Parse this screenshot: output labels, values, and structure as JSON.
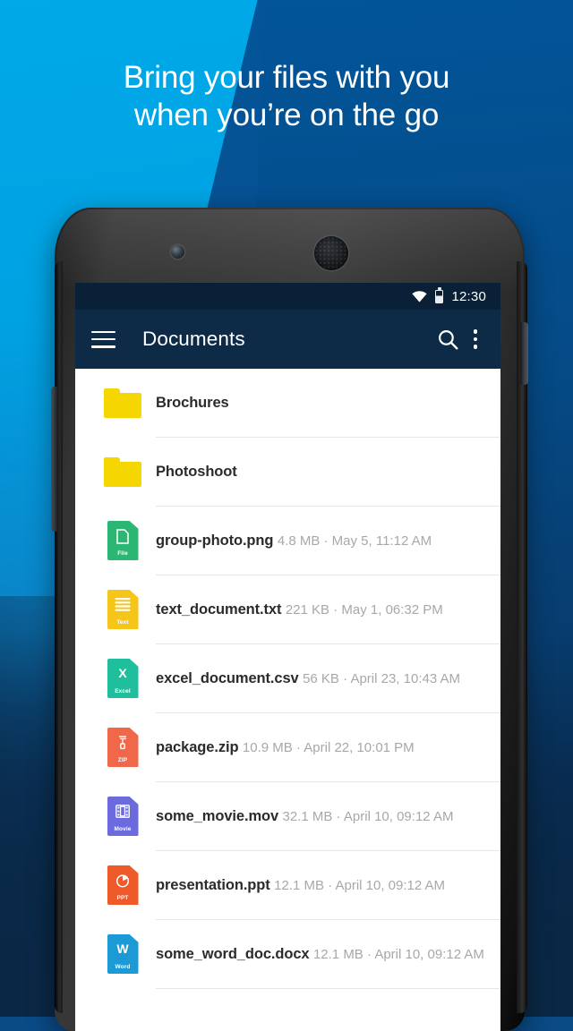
{
  "promo": {
    "headline_line1": "Bring your files with you",
    "headline_line2": "when you’re on the go",
    "bg_color_light": "#00a9e8",
    "bg_color_mid": "#04559a",
    "bg_color_dark": "#0a2845"
  },
  "device": {
    "front_camera": "camera-icon",
    "earpiece_speaker": "speaker-grille-icon",
    "volume_button": "volume-rocker",
    "power_button": "power-button"
  },
  "statusbar": {
    "wifi_icon": "wifi-icon",
    "battery_icon": "battery-icon",
    "time": "12:30",
    "background": "#0a2037"
  },
  "appbar": {
    "menu_icon": "hamburger-menu-icon",
    "title": "Documents",
    "search_icon": "search-icon",
    "overflow_icon": "more-vertical-icon",
    "background": "#0d2a47"
  },
  "filelist": [
    {
      "type": "folder",
      "icon": "folder-icon",
      "icon_color": "#f5d600",
      "name": "Brochures",
      "subtitle": ""
    },
    {
      "type": "folder",
      "icon": "folder-icon",
      "icon_color": "#f5d600",
      "name": "Photoshoot",
      "subtitle": ""
    },
    {
      "type": "file",
      "icon": "file-icon",
      "icon_color": "#2bb673",
      "badge": "File",
      "glyph": "page",
      "name": "group-photo.png",
      "size": "4.8 MB",
      "date": "May 5, 11:12 AM",
      "subtitle": "4.8 MB · May 5, 11:12 AM"
    },
    {
      "type": "file",
      "icon": "text-file-icon",
      "icon_color": "#f5c518",
      "badge": "Text",
      "glyph": "lines",
      "name": "text_document.txt",
      "size": "221 KB",
      "date": "May 1, 06:32 PM",
      "subtitle": "221 KB · May 1, 06:32 PM"
    },
    {
      "type": "file",
      "icon": "excel-file-icon",
      "icon_color": "#1fbe9c",
      "badge": "Excel",
      "glyph": "X",
      "name": "excel_document.csv",
      "size": "56 KB",
      "date": "April 23, 10:43 AM",
      "subtitle": "56 KB · April 23, 10:43 AM"
    },
    {
      "type": "file",
      "icon": "zip-file-icon",
      "icon_color": "#f0674a",
      "badge": "ZIP",
      "glyph": "zipper",
      "name": "package.zip",
      "size": "10.9 MB",
      "date": "April 22, 10:01 PM",
      "subtitle": "10.9 MB · April 22, 10:01 PM"
    },
    {
      "type": "file",
      "icon": "movie-file-icon",
      "icon_color": "#6b6bdd",
      "badge": "Movie",
      "glyph": "film",
      "name": "some_movie.mov",
      "size": "32.1 MB",
      "date": "April 10, 09:12 AM",
      "subtitle": "32.1 MB · April 10, 09:12 AM"
    },
    {
      "type": "file",
      "icon": "ppt-file-icon",
      "icon_color": "#ef5a2a",
      "badge": "PPT",
      "glyph": "pie",
      "name": "presentation.ppt",
      "size": "12.1 MB",
      "date": "April 10, 09:12 AM",
      "subtitle": "12.1 MB · April 10, 09:12 AM"
    },
    {
      "type": "file",
      "icon": "word-file-icon",
      "icon_color": "#1b9ad6",
      "badge": "Word",
      "glyph": "W",
      "name": "some_word_doc.docx",
      "size": "12.1 MB",
      "date": "April 10, 09:12 AM",
      "subtitle": "12.1 MB · April 10, 09:12 AM"
    }
  ]
}
